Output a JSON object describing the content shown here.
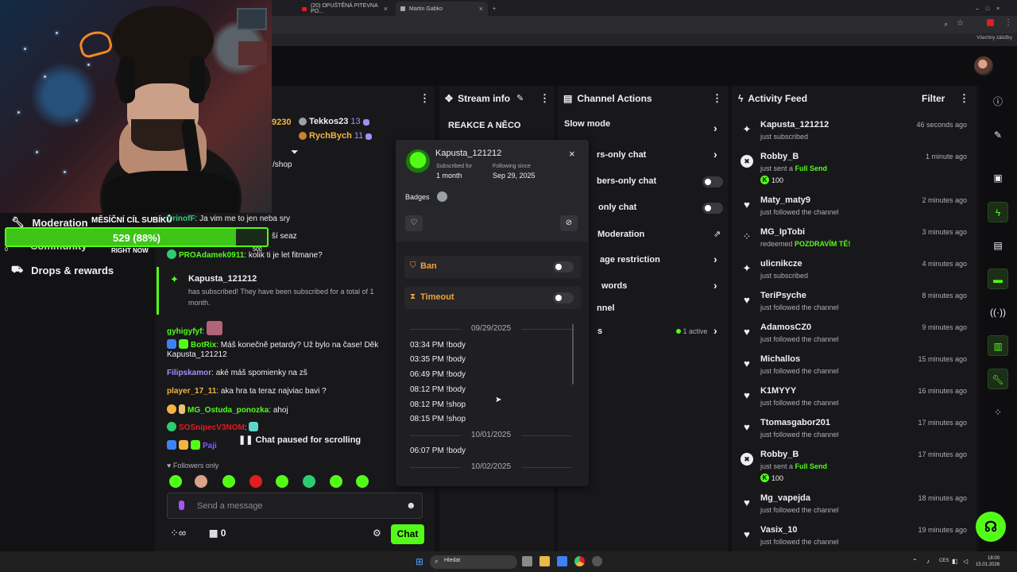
{
  "browser": {
    "tabs": [
      {
        "label": "(20) OPUŠTĚNÁ PITEVNA PO..."
      },
      {
        "label": "Martin Gabko"
      }
    ],
    "bookmarks_label": "Všechny záložky"
  },
  "overlay": {
    "goal_title": "MĚSÍČNÍ CÍL SUBÍKŮ",
    "goal_text": "529 (88%)",
    "goal_progress": 0.88,
    "goal_right": "RIGHT NOW",
    "goal_badge_left": "0",
    "goal_badge_right": "500"
  },
  "leftnav": {
    "items": [
      {
        "label": "Moderation",
        "icon": "wrench-icon"
      },
      {
        "label": "Community",
        "icon": "people-icon"
      },
      {
        "label": "Drops & rewards",
        "icon": "gift-icon"
      }
    ]
  },
  "chat": {
    "pinned_count": "9230",
    "top_gifters": [
      {
        "name": "Tekkos23",
        "count": "13"
      },
      {
        "name": "RychBych",
        "count": "11"
      }
    ],
    "shop_fragment": "/shop",
    "messages": [
      {
        "user": "DrinofF",
        "text": "Ja vim me to jen neba sry",
        "color": "#2ecc71"
      },
      {
        "user": "",
        "text": "ší seaz",
        "color": "#efeff1"
      },
      {
        "user": "PROAdamek0911",
        "text": "kolik ti je let fitmane?",
        "color": "#53fc18"
      },
      {
        "user": "gyhigyfyf",
        "text": "",
        "color": "#53fc18"
      },
      {
        "user": "BotRix",
        "text": "Máš konečně petardy? Už bylo na čase! Děk",
        "color": "#53fc18"
      },
      {
        "user": "",
        "text": "Kapusta_121212",
        "color": "#efeff1"
      },
      {
        "user": "Filipskamor",
        "text": "aké máš spomienky na zš",
        "color": "#a78bfa"
      },
      {
        "user": "player_17_11",
        "text": "aka hra ta teraz najviac bavi ?",
        "color": "#f5b342"
      },
      {
        "user": "MG_Ostuda_ponozka",
        "text": "ahoj",
        "color": "#53fc18"
      },
      {
        "user": "SOSnipecV3NOM",
        "text": "",
        "color": "#e01e1e"
      },
      {
        "user": "Paji",
        "text": "",
        "color": "#7c5cff"
      }
    ],
    "sub_notice": {
      "user": "Kapusta_121212",
      "text": "has subscribed! They have been subscribed for a total of 1 month."
    },
    "paused": "Chat paused for scrolling",
    "followers_only": "Followers only",
    "input_placeholder": "Send a message",
    "points": "0",
    "chat_button": "Chat"
  },
  "stream_info": {
    "title": "Stream info",
    "stream_title": "REAKCE A NĚCO"
  },
  "channel_actions": {
    "title": "Channel Actions",
    "rows": [
      {
        "label": "Slow mode",
        "type": "chevron"
      },
      {
        "label": "rs-only chat",
        "type": "chevron"
      },
      {
        "label": "bers-only chat",
        "type": "toggle"
      },
      {
        "label": "only chat",
        "type": "toggle"
      },
      {
        "label": "Moderation",
        "type": "external"
      },
      {
        "label": "age restriction",
        "type": "chevron"
      },
      {
        "label": "words",
        "type": "chevron"
      },
      {
        "label": "nnel",
        "type": "none"
      },
      {
        "label": "s",
        "type": "active"
      }
    ],
    "active_label": "1 active"
  },
  "user_card": {
    "username": "Kapusta_121212",
    "subscribed_label": "Subscribed for",
    "subscribed_value": "1 month",
    "following_label": "Following since",
    "following_value": "Sep 29, 2025",
    "badges_label": "Badges",
    "ban_label": "Ban",
    "timeout_label": "Timeout",
    "history": [
      {
        "date": "09/29/2025",
        "lines": [
          "03:34 PM !body",
          "03:35 PM !body",
          "06:49 PM !body",
          "08:12 PM !body",
          "08:12 PM !shop",
          "08:15 PM !shop"
        ]
      },
      {
        "date": "10/01/2025",
        "lines": [
          "06:07 PM !body"
        ]
      },
      {
        "date": "10/02/2025",
        "lines": []
      }
    ]
  },
  "activity": {
    "title": "Activity Feed",
    "filter": "Filter",
    "items": [
      {
        "name": "Kapusta_121212",
        "desc": "just subscribed",
        "time": "46 seconds ago",
        "icon": "sparkle-icon"
      },
      {
        "name": "Robby_B",
        "desc": "just sent a",
        "highlight": "Full Send",
        "amount": "100",
        "time": "1 minute ago",
        "icon": "kick-icon"
      },
      {
        "name": "Maty_maty9",
        "desc": "just followed the channel",
        "time": "2 minutes ago",
        "icon": "heart-icon"
      },
      {
        "name": "MG_IpTobi",
        "desc": "redeemed",
        "highlight": "POZDRAVÍM TĚ!",
        "time": "3 minutes ago",
        "icon": "reward-icon"
      },
      {
        "name": "ulicnikcze",
        "desc": "just subscribed",
        "time": "4 minutes ago",
        "icon": "sparkle-icon"
      },
      {
        "name": "TeriPsyche",
        "desc": "just followed the channel",
        "time": "8 minutes ago",
        "icon": "heart-icon"
      },
      {
        "name": "AdamosCZ0",
        "desc": "just followed the channel",
        "time": "9 minutes ago",
        "icon": "heart-icon"
      },
      {
        "name": "Michallos",
        "desc": "just followed the channel",
        "time": "15 minutes ago",
        "icon": "heart-icon"
      },
      {
        "name": "K1MYYY",
        "desc": "just followed the channel",
        "time": "16 minutes ago",
        "icon": "heart-icon"
      },
      {
        "name": "Ttomasgabor201",
        "desc": "just followed the channel",
        "time": "17 minutes ago",
        "icon": "heart-icon"
      },
      {
        "name": "Robby_B",
        "desc": "just sent a",
        "highlight": "Full Send",
        "amount": "100",
        "time": "17 minutes ago",
        "icon": "kick-icon"
      },
      {
        "name": "Mg_vapejda",
        "desc": "just followed the channel",
        "time": "18 minutes ago",
        "icon": "heart-icon"
      },
      {
        "name": "Vasix_10",
        "desc": "just followed the channel",
        "time": "19 minutes ago",
        "icon": "heart-icon"
      }
    ]
  },
  "taskbar": {
    "search": "Hledat",
    "lang": "CES",
    "time": "18:00",
    "date": "15.01.2026"
  },
  "colors": {
    "accent": "#53fc18",
    "warn": "#f0a33a"
  }
}
